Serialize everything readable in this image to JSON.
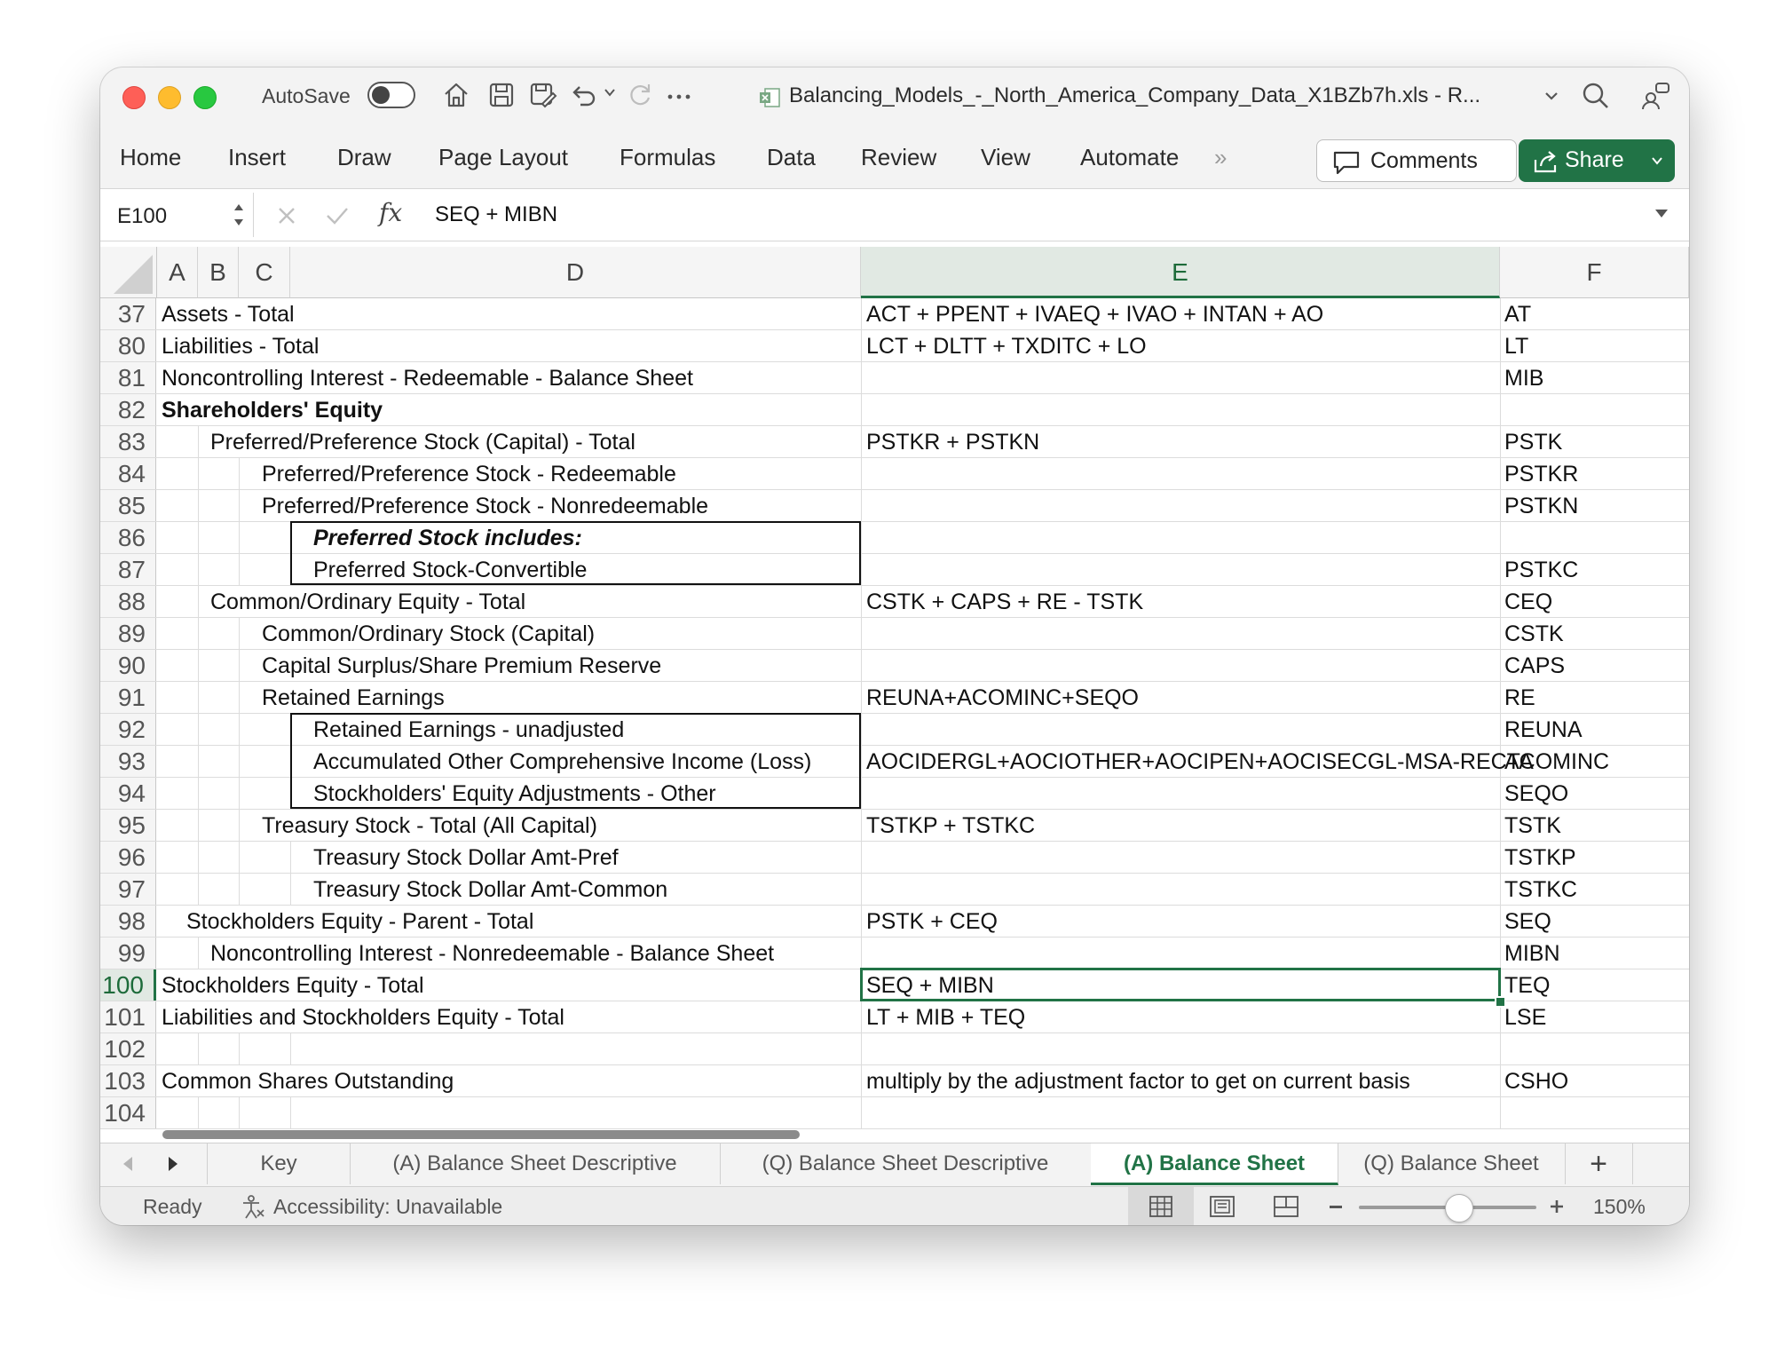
{
  "window": {
    "autosave_label": "AutoSave",
    "autosave_on": false,
    "title": "Balancing_Models_-_North_America_Company_Data_X1BZb7h.xls  -  R..."
  },
  "ribbon": {
    "tabs": [
      "Home",
      "Insert",
      "Draw",
      "Page Layout",
      "Formulas",
      "Data",
      "Review",
      "View",
      "Automate"
    ],
    "more_glyph": "»",
    "comments_label": "Comments",
    "share_label": "Share"
  },
  "formula_bar": {
    "name_box": "E100",
    "fx": "fx",
    "formula": "SEQ + MIBN"
  },
  "columns": [
    "A",
    "B",
    "C",
    "D",
    "E",
    "F"
  ],
  "selected_column": "E",
  "selected_cell": "E100",
  "rows": [
    {
      "num": "37",
      "label": "Assets - Total",
      "style": "normal",
      "formula": "ACT + PPENT + IVAEQ + IVAO + INTAN + AO",
      "code": "AT"
    },
    {
      "num": "80",
      "label": "Liabilities - Total",
      "style": "normal",
      "formula": "LCT + DLTT + TXDITC + LO",
      "code": "LT"
    },
    {
      "num": "81",
      "label": "Noncontrolling Interest - Redeemable - Balance Sheet",
      "style": "normal",
      "formula": "",
      "code": "MIB"
    },
    {
      "num": "82",
      "label": "Shareholders' Equity",
      "style": "bold",
      "formula": "",
      "code": ""
    },
    {
      "num": "83",
      "label": "Preferred/Preference Stock (Capital) - Total",
      "style": "normal",
      "formula": "PSTKR + PSTKN",
      "code": "PSTK"
    },
    {
      "num": "84",
      "label": "Preferred/Preference Stock - Redeemable",
      "style": "normal",
      "formula": "",
      "code": "PSTKR"
    },
    {
      "num": "85",
      "label": "Preferred/Preference Stock - Nonredeemable",
      "style": "normal",
      "formula": "",
      "code": "PSTKN"
    },
    {
      "num": "86",
      "label": "Preferred Stock includes:",
      "style": "bold-italic",
      "formula": "",
      "code": ""
    },
    {
      "num": "87",
      "label": "Preferred Stock-Convertible",
      "style": "normal",
      "formula": "",
      "code": "PSTKC"
    },
    {
      "num": "88",
      "label": "Common/Ordinary Equity - Total",
      "style": "normal",
      "formula": "CSTK + CAPS + RE - TSTK",
      "code": "CEQ"
    },
    {
      "num": "89",
      "label": "Common/Ordinary Stock (Capital)",
      "style": "normal",
      "formula": "",
      "code": "CSTK"
    },
    {
      "num": "90",
      "label": "Capital Surplus/Share Premium Reserve",
      "style": "normal",
      "formula": "",
      "code": "CAPS"
    },
    {
      "num": "91",
      "label": "Retained Earnings",
      "style": "normal",
      "formula": "REUNA+ACOMINC+SEQO",
      "code": "RE"
    },
    {
      "num": "92",
      "label": "Retained Earnings - unadjusted",
      "style": "normal",
      "formula": "",
      "code": "REUNA"
    },
    {
      "num": "93",
      "label": "Accumulated Other Comprehensive Income (Loss)",
      "style": "normal",
      "formula": "AOCIDERGL+AOCIOTHER+AOCIPEN+AOCISECGL-MSA-RECTA",
      "code": "ACOMINC"
    },
    {
      "num": "94",
      "label": "Stockholders' Equity Adjustments - Other",
      "style": "normal",
      "formula": "",
      "code": "SEQO"
    },
    {
      "num": "95",
      "label": "Treasury Stock - Total (All Capital)",
      "style": "normal",
      "formula": "TSTKP + TSTKC",
      "code": "TSTK"
    },
    {
      "num": "96",
      "label": "Treasury Stock Dollar Amt-Pref",
      "style": "normal",
      "formula": "",
      "code": "TSTKP"
    },
    {
      "num": "97",
      "label": "Treasury Stock Dollar Amt-Common",
      "style": "normal",
      "formula": "",
      "code": "TSTKC"
    },
    {
      "num": "98",
      "label": "Stockholders Equity - Parent - Total",
      "style": "normal",
      "formula": "PSTK + CEQ",
      "code": "SEQ"
    },
    {
      "num": "99",
      "label": "Noncontrolling Interest - Nonredeemable - Balance Sheet",
      "style": "normal",
      "formula": "",
      "code": "MIBN"
    },
    {
      "num": "100",
      "label": "Stockholders Equity - Total",
      "style": "normal",
      "formula": "SEQ + MIBN",
      "code": "TEQ"
    },
    {
      "num": "101",
      "label": "Liabilities and Stockholders Equity - Total",
      "style": "normal",
      "formula": "LT + MIB + TEQ",
      "code": "LSE"
    },
    {
      "num": "102",
      "label": "",
      "style": "normal",
      "formula": "",
      "code": ""
    },
    {
      "num": "103",
      "label": "Common Shares Outstanding",
      "style": "normal",
      "formula": "multiply by the adjustment factor to get on current basis",
      "code": "CSHO"
    },
    {
      "num": "104",
      "label": "",
      "style": "normal",
      "formula": "",
      "code": ""
    }
  ],
  "sheet_tabs": {
    "items": [
      "Key",
      "(A) Balance Sheet Descriptive",
      "(Q) Balance Sheet Descriptive",
      "(A) Balance Sheet",
      "(Q) Balance Sheet"
    ],
    "active": "(A) Balance Sheet",
    "add_label": "+"
  },
  "status_bar": {
    "ready": "Ready",
    "accessibility": "Accessibility: Unavailable",
    "zoom": "150%",
    "zoom_level_percent": 150
  },
  "colors": {
    "accent": "#217346",
    "close": "#fe5f57",
    "minimize": "#febc2e",
    "maximize": "#28c840"
  }
}
